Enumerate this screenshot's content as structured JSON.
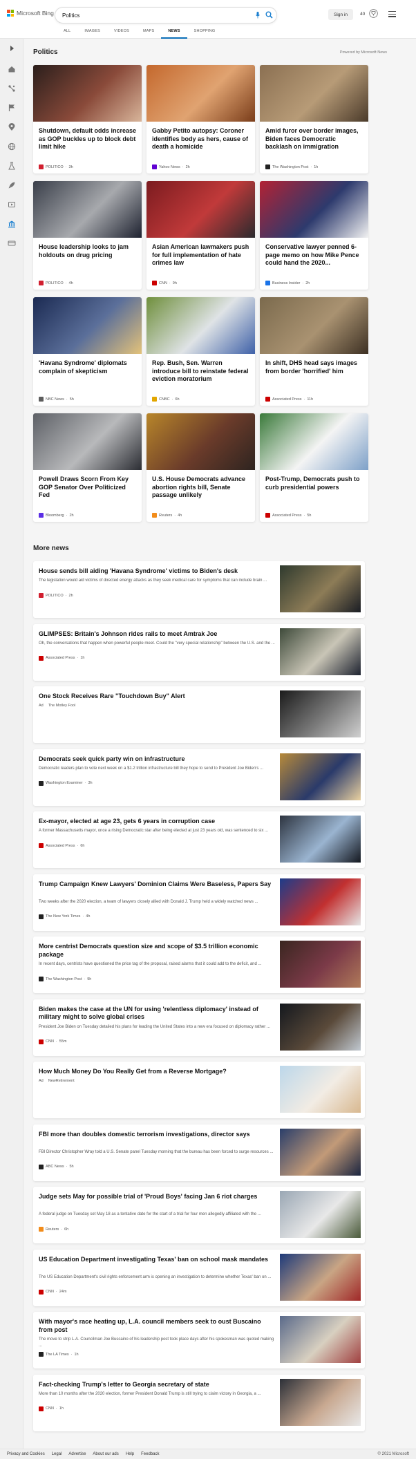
{
  "header": {
    "brand": "Microsoft Bing",
    "logo_colors": [
      "#f25022",
      "#7fba00",
      "#00a4ef",
      "#ffb900"
    ],
    "search_value": "Politics",
    "signin_label": "Sign in",
    "points": "40",
    "icons": [
      "microphone-icon",
      "search-icon",
      "trophy-icon",
      "hamburger-menu-icon"
    ]
  },
  "tabs": [
    {
      "label": "ALL",
      "active": false
    },
    {
      "label": "IMAGES",
      "active": false
    },
    {
      "label": "VIDEOS",
      "active": false
    },
    {
      "label": "MAPS",
      "active": false
    },
    {
      "label": "NEWS",
      "active": true
    },
    {
      "label": "SHOPPING",
      "active": false
    }
  ],
  "rail": {
    "icons": [
      "expand-icon",
      "home-icon",
      "network-icon",
      "flag-icon",
      "location-icon",
      "globe-icon",
      "science-icon",
      "rocket-icon",
      "entertainment-icon",
      "politics-icon",
      "money-icon"
    ]
  },
  "section": {
    "title": "Politics",
    "powered_by": "Powered by Microsoft News"
  },
  "cards": [
    {
      "title": "Shutdown, default odds increase as GOP buckles up to block debt limit hike",
      "source": "POLITICO",
      "time": "3h",
      "logo_color": "#d11f2f",
      "img": [
        "#2b1f1c",
        "#8a4a3a",
        "#d8b59a"
      ]
    },
    {
      "title": "Gabby Petito autopsy: Coroner identifies body as hers, cause of death a homicide",
      "source": "Yahoo News",
      "time": "2h",
      "logo_color": "#6001d2",
      "img": [
        "#c4682d",
        "#e0a371",
        "#7a3d1a"
      ]
    },
    {
      "title": "Amid furor over border images, Biden faces Democratic backlash on immigration",
      "source": "The Washington Post",
      "time": "1h",
      "logo_color": "#222222",
      "img": [
        "#8b7052",
        "#b79b77",
        "#4a3a2a"
      ]
    },
    {
      "title": "House leadership looks to jam holdouts on drug pricing",
      "source": "POLITICO",
      "time": "4h",
      "logo_color": "#d11f2f",
      "img": [
        "#3a3f4a",
        "#a7a9ad",
        "#1e2230"
      ]
    },
    {
      "title": "Asian American lawmakers push for full implementation of hate crimes law",
      "source": "CNN",
      "time": "9h",
      "logo_color": "#cc0000",
      "img": [
        "#7b1b1f",
        "#c13a3a",
        "#2a2a2e"
      ]
    },
    {
      "title": "Conservative lawyer penned 6-page memo on how Mike Pence could hand the 2020...",
      "source": "Business Insider",
      "time": "2h",
      "logo_color": "#1a73e8",
      "img": [
        "#b22234",
        "#2d3a6d",
        "#f2f2f2"
      ]
    },
    {
      "title": "'Havana Syndrome' diplomats complain of skepticism",
      "source": "NBC News",
      "time": "5h",
      "logo_color": "#5d5d5d",
      "img": [
        "#1b2a52",
        "#5b6f9a",
        "#e3c27a"
      ]
    },
    {
      "title": "Rep. Bush, Sen. Warren introduce bill to reinstate federal eviction moratorium",
      "source": "CNBC",
      "time": "6h",
      "logo_color": "#e2a600",
      "img": [
        "#6f8f3c",
        "#dfe3e6",
        "#3f61a8"
      ]
    },
    {
      "title": "In shift, DHS head says images from border 'horrified' him",
      "source": "Associated Press",
      "time": "11h",
      "logo_color": "#cc0000",
      "img": [
        "#7b6a4d",
        "#a99271",
        "#3d3023"
      ]
    },
    {
      "title": "Powell Draws Scorn From Key GOP Senator Over Politicized Fed",
      "source": "Bloomberg",
      "time": "2h",
      "logo_color": "#5b2ee5",
      "img": [
        "#5d6066",
        "#b8b9bb",
        "#2b2d33"
      ]
    },
    {
      "title": "U.S. House Democrats advance abortion rights bill, Senate passage unlikely",
      "source": "Reuters",
      "time": "4h",
      "logo_color": "#f28c1a",
      "img": [
        "#b8862a",
        "#6a3b2a",
        "#2e2420"
      ]
    },
    {
      "title": "Post-Trump, Democrats push to curb presidential powers",
      "source": "Associated Press",
      "time": "5h",
      "logo_color": "#cc0000",
      "img": [
        "#3a7a3a",
        "#f4f4f4",
        "#7da0c8"
      ]
    }
  ],
  "more_news": {
    "title": "More news",
    "items": [
      {
        "title": "House sends bill aiding 'Havana Syndrome' victims to Biden's desk",
        "desc": "The legislation would aid victims of directed energy attacks as they seek medical care for symptoms that can include brain ...",
        "ad": "",
        "source": "POLITICO",
        "time": "2h",
        "logo_color": "#d11f2f",
        "img": [
          "#2f3a2e",
          "#8d7c57",
          "#1a1d24"
        ]
      },
      {
        "title": "GLIMPSES: Britain's Johnson rides rails to meet Amtrak Joe",
        "desc": "Oh, the conversations that happen when powerful people meet. Could the \"very special relationship\" between the U.S. and the ...",
        "ad": "",
        "source": "Associated Press",
        "time": "1h",
        "logo_color": "#cc0000",
        "img": [
          "#3e4a3a",
          "#c9c5b6",
          "#1e2330"
        ]
      },
      {
        "title": "One Stock Receives Rare \"Touchdown Buy\" Alert",
        "desc": "",
        "ad": "Ad",
        "source": "The Motley Fool",
        "time": "",
        "logo_color": "",
        "img": [
          "#1b1b1b",
          "#7a7a7a",
          "#d0d0d0"
        ]
      },
      {
        "title": "Democrats seek quick party win on infrastructure",
        "desc": "Democratic leaders plan to vote next week on a $1.2 trillion infrastructure bill they hope to send to President Joe Biden's ...",
        "ad": "",
        "source": "Washington Examiner",
        "time": "3h",
        "logo_color": "#222222",
        "img": [
          "#b78a3a",
          "#2a3a6a",
          "#e8d0a0"
        ]
      },
      {
        "title": "Ex-mayor, elected at age 23, gets 6 years in corruption case",
        "desc": "A former Massachusetts mayor, once a rising Democratic star after being elected at just 23 years old, was sentenced to six ...",
        "ad": "",
        "source": "Associated Press",
        "time": "6h",
        "logo_color": "#cc0000",
        "img": [
          "#2d3440",
          "#9ab4d0",
          "#141820"
        ]
      },
      {
        "title": "Trump Campaign Knew Lawyers' Dominion Claims Were Baseless, Papers Say",
        "desc": "Two weeks after the 2020 election, a team of lawyers closely allied with Donald J. Trump held a widely watched news ...",
        "ad": "",
        "source": "The New York Times",
        "time": "4h",
        "logo_color": "#222222",
        "img": [
          "#1d3c8a",
          "#c23030",
          "#e5e5e5"
        ]
      },
      {
        "title": "More centrist Democrats question size and scope of $3.5 trillion economic package",
        "desc": "In recent days, centrists have questioned the price tag of the proposal, raised alarms that it could add to the deficit, and ...",
        "ad": "",
        "source": "The Washington Post",
        "time": "9h",
        "logo_color": "#222222",
        "img": [
          "#3a2620",
          "#7b3a48",
          "#b07a5a"
        ]
      },
      {
        "title": "Biden makes the case at the UN for using 'relentless diplomacy' instead of military might to solve global crises",
        "desc": "President Joe Biden on Tuesday detailed his plans for leading the United States into a new era focused on diplomacy rather ...",
        "ad": "",
        "source": "CNN",
        "time": "55m",
        "logo_color": "#cc0000",
        "img": [
          "#14181e",
          "#5a4a3a",
          "#c0c8d0"
        ]
      },
      {
        "title": "How Much Money Do You Really Get from a Reverse Mortgage?",
        "desc": "",
        "ad": "Ad",
        "source": "NewRetirement",
        "time": "",
        "logo_color": "",
        "img": [
          "#bcd7ea",
          "#f2ece4",
          "#d8b890"
        ]
      },
      {
        "title": "FBI more than doubles domestic terrorism investigations, director says",
        "desc": "FBI Director Christopher Wray told a U.S. Senate panel Tuesday morning that the bureau has been forced to surge resources ...",
        "ad": "",
        "source": "ABC News",
        "time": "5h",
        "logo_color": "#222222",
        "img": [
          "#2a3e6a",
          "#c29a78",
          "#1b2540"
        ]
      },
      {
        "title": "Judge sets May for possible trial of 'Proud Boys' facing Jan 6 riot charges",
        "desc": "A federal judge on Tuesday set May 18 as a tentative date for the start of a trial for four men allegedly affiliated with the ...",
        "ad": "",
        "source": "Reuters",
        "time": "6h",
        "logo_color": "#f28c1a",
        "img": [
          "#9aa7b4",
          "#e8e8e8",
          "#4a5a3a"
        ]
      },
      {
        "title": "US Education Department investigating Texas' ban on school mask mandates",
        "desc": "The US Education Department's civil rights enforcement arm is opening an investigation to determine whether Texas' ban on ...",
        "ad": "",
        "source": "CNN",
        "time": "24m",
        "logo_color": "#cc0000",
        "img": [
          "#1e3a7a",
          "#c9a584",
          "#a02828"
        ]
      },
      {
        "title": "With mayor's race heating up, L.A. council members seek to oust Buscaino from post",
        "desc": "The move to strip L.A. Councilman Joe Buscaino of his leadership post took place days after his spokesman was quoted making ...",
        "ad": "",
        "source": "The LA Times",
        "time": "1h",
        "logo_color": "#222222",
        "img": [
          "#5a6a8a",
          "#d8d0c0",
          "#a04040"
        ]
      },
      {
        "title": "Fact-checking Trump's letter to Georgia secretary of state",
        "desc": "More than 10 months after the 2020 election, former President Donald Trump is still trying to claim victory in Georgia, a ...",
        "ad": "",
        "source": "CNN",
        "time": "1h",
        "logo_color": "#cc0000",
        "img": [
          "#2c3038",
          "#c8a890",
          "#e8e8e8"
        ]
      }
    ]
  },
  "footer": {
    "links": [
      "Privacy and Cookies",
      "Legal",
      "Advertise",
      "About our ads",
      "Help",
      "Feedback"
    ],
    "copyright": "© 2021 Microsoft"
  },
  "accent_color": "#0b6fb8"
}
